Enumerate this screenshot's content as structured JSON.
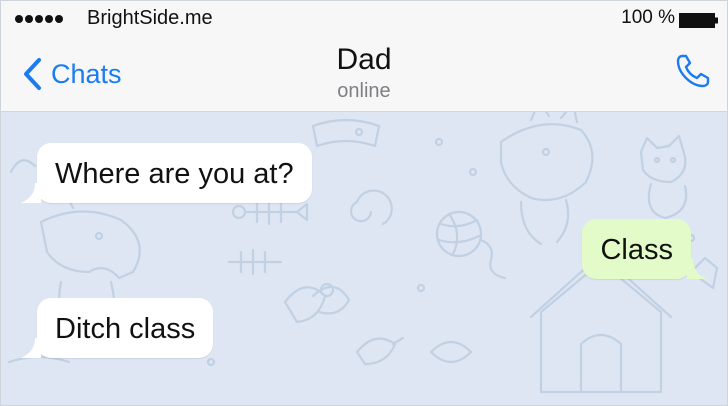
{
  "status_bar": {
    "carrier": "BrightSide.me",
    "battery_percent": "100 %",
    "signal_dots": 5
  },
  "nav": {
    "back_label": "Chats",
    "contact_name": "Dad",
    "contact_status": "online",
    "back_icon": "chevron-left-icon",
    "call_icon": "phone-icon"
  },
  "messages": [
    {
      "sender": "contact",
      "text": "Where are you at?"
    },
    {
      "sender": "me",
      "text": "Class"
    },
    {
      "sender": "contact",
      "text": "Ditch class"
    }
  ],
  "colors": {
    "accent": "#1b7cf2",
    "chat_background": "#dde6f2",
    "incoming_bubble": "#ffffff",
    "outgoing_bubble": "#e2fbc9"
  }
}
